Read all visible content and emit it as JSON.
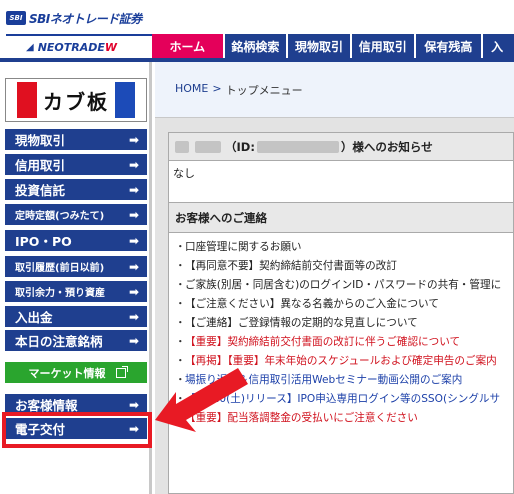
{
  "header": {
    "sbi_mark": "SBI",
    "sbi_title": "SBIネオトレード証券",
    "neo_title": "NEOTRADE",
    "neo_w": "W"
  },
  "gnav": {
    "tabs": [
      {
        "label": "ホーム",
        "active": true
      },
      {
        "label": "銘柄検索",
        "active": false
      },
      {
        "label": "現物取引",
        "active": false
      },
      {
        "label": "信用取引",
        "active": false
      },
      {
        "label": "保有残高",
        "active": false
      },
      {
        "label": "入",
        "active": false
      }
    ]
  },
  "sidebar": {
    "banner": "カブ板",
    "items": [
      {
        "label": "現物取引",
        "arrow": "➡"
      },
      {
        "label": "信用取引",
        "arrow": "➡"
      },
      {
        "label": "投資信託",
        "arrow": "➡"
      },
      {
        "label": "定時定額(つみたて)",
        "arrow": "➡"
      },
      {
        "label": "IPO・PO",
        "arrow": "➡"
      },
      {
        "label": "取引履歴(前日以前)",
        "arrow": "➡"
      },
      {
        "label": "取引余力・預り資産",
        "arrow": "➡"
      },
      {
        "label": "入出金",
        "arrow": "➡"
      },
      {
        "label": "本日の注意銘柄",
        "arrow": "➡"
      },
      {
        "label": "マーケット情報"
      },
      {
        "label": "お客様情報",
        "arrow": "➡"
      },
      {
        "label": "電子交付",
        "arrow": "➡"
      }
    ]
  },
  "main": {
    "breadcrumb": {
      "home": "HOME",
      "sep": ">",
      "current": "トップメニュー"
    },
    "notice": {
      "id_label": "（ID:",
      "title_suffix": "）様へのお知らせ",
      "body": "なし"
    },
    "contact": {
      "title": "お客様へのご連絡",
      "bullet": "・",
      "items": [
        {
          "text": "口座管理に関するお願い",
          "color": "black"
        },
        {
          "text": "【再同意不要】契約締結前交付書面等の改訂",
          "color": "black"
        },
        {
          "text": "ご家族(別居・同居含む)のログインID・パスワードの共有・管理に",
          "color": "black"
        },
        {
          "text": "【ご注意ください】異なる名義からのご入金について",
          "color": "black"
        },
        {
          "text": "【ご連絡】ご登録情報の定期的な見直しについて",
          "color": "black"
        },
        {
          "text": "【重要】契約締結前交付書面の改訂に伴うご確認について",
          "color": "red"
        },
        {
          "text": "【再掲】【重要】年末年始のスケジュールおよび確定申告のご案内",
          "color": "red"
        },
        {
          "text": "場振り返り＆信用取引活用Webセミナー動画公開のご案内",
          "color": "blue"
        },
        {
          "text": "【12/20(土)リリース】IPO申込専用ログイン等のSSO(シングルサ",
          "color": "blue"
        },
        {
          "text": "【重要】配当落調整金の受払いにご注意ください",
          "color": "red"
        }
      ]
    }
  },
  "colors": {
    "nav_blue": "#1f3f8f",
    "home_pink": "#e4005a",
    "market_green": "#2aa52e",
    "annotation_red": "#e81a24"
  }
}
